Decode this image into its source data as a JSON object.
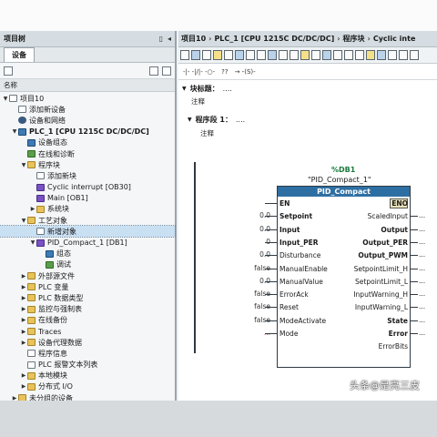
{
  "left_pane": {
    "title": "项目树",
    "tab": "设备",
    "column_header": "名称",
    "items": [
      {
        "label": "项目10",
        "level": 0,
        "toggle": "▼",
        "icon": "doc"
      },
      {
        "label": "添加新设备",
        "level": 1,
        "toggle": "",
        "icon": "doc"
      },
      {
        "label": "设备和网络",
        "level": 1,
        "toggle": "",
        "icon": "gear"
      },
      {
        "label": "PLC_1 [CPU 1215C DC/DC/DC]",
        "level": 1,
        "toggle": "▼",
        "icon": "cpu",
        "bold": true
      },
      {
        "label": "设备组态",
        "level": 2,
        "toggle": "",
        "icon": "cpu"
      },
      {
        "label": "在线和诊断",
        "level": 2,
        "toggle": "",
        "icon": "grn"
      },
      {
        "label": "程序块",
        "level": 2,
        "toggle": "▼",
        "icon": "folder"
      },
      {
        "label": "添加新块",
        "level": 3,
        "toggle": "",
        "icon": "doc"
      },
      {
        "label": "Cyclic interrupt [OB30]",
        "level": 3,
        "toggle": "",
        "icon": "blk"
      },
      {
        "label": "Main [OB1]",
        "level": 3,
        "toggle": "",
        "icon": "blk"
      },
      {
        "label": "系统块",
        "level": 3,
        "toggle": "▶",
        "icon": "folder"
      },
      {
        "label": "工艺对象",
        "level": 2,
        "toggle": "▼",
        "icon": "folder"
      },
      {
        "label": "新增对象",
        "level": 3,
        "toggle": "",
        "icon": "doc",
        "selected": true
      },
      {
        "label": "PID_Compact_1 [DB1]",
        "level": 3,
        "toggle": "▼",
        "icon": "blk"
      },
      {
        "label": "组态",
        "level": 4,
        "toggle": "",
        "icon": "cpu"
      },
      {
        "label": "调试",
        "level": 4,
        "toggle": "",
        "icon": "grn"
      },
      {
        "label": "外部源文件",
        "level": 2,
        "toggle": "▶",
        "icon": "folder"
      },
      {
        "label": "PLC 变量",
        "level": 2,
        "toggle": "▶",
        "icon": "folder"
      },
      {
        "label": "PLC 数据类型",
        "level": 2,
        "toggle": "▶",
        "icon": "folder"
      },
      {
        "label": "监控与强制表",
        "level": 2,
        "toggle": "▶",
        "icon": "folder"
      },
      {
        "label": "在线备份",
        "level": 2,
        "toggle": "▶",
        "icon": "folder"
      },
      {
        "label": "Traces",
        "level": 2,
        "toggle": "▶",
        "icon": "folder"
      },
      {
        "label": "设备代理数据",
        "level": 2,
        "toggle": "▶",
        "icon": "folder"
      },
      {
        "label": "程序信息",
        "level": 2,
        "toggle": "",
        "icon": "doc"
      },
      {
        "label": "PLC 报警文本列表",
        "level": 2,
        "toggle": "",
        "icon": "doc"
      },
      {
        "label": "本地模块",
        "level": 2,
        "toggle": "▶",
        "icon": "folder"
      },
      {
        "label": "分布式 I/O",
        "level": 2,
        "toggle": "▶",
        "icon": "folder"
      },
      {
        "label": "未分组的设备",
        "level": 1,
        "toggle": "▶",
        "icon": "folder"
      }
    ]
  },
  "right_pane": {
    "breadcrumb": [
      "项目10",
      "PLC_1 [CPU 1215C DC/DC/DC]",
      "程序块",
      "Cyclic inte"
    ],
    "favorites": [
      "-|- -|/|- -○- ",
      "?? ",
      "→ -(S)-"
    ],
    "block_title_label": "块标题：",
    "block_title_value": "....",
    "block_comment": "注释",
    "network_label": "程序段 1：",
    "network_value": "....",
    "network_comment": "注释"
  },
  "block": {
    "db": "%DB1",
    "instance": "\"PID_Compact_1\"",
    "name": "PID_Compact",
    "inputs": [
      {
        "pin": "EN",
        "value": "",
        "bold": true
      },
      {
        "pin": "Setpoint",
        "value": "0.0",
        "bold": true
      },
      {
        "pin": "Input",
        "value": "0.0",
        "bold": true
      },
      {
        "pin": "Input_PER",
        "value": "0",
        "bold": true
      },
      {
        "pin": "Disturbance",
        "value": "0.0",
        "bold": false
      },
      {
        "pin": "ManualEnable",
        "value": "false",
        "bold": false
      },
      {
        "pin": "ManualValue",
        "value": "0.0",
        "bold": false
      },
      {
        "pin": "ErrorAck",
        "value": "false",
        "bold": false
      },
      {
        "pin": "Reset",
        "value": "false",
        "bold": false
      },
      {
        "pin": "ModeActivate",
        "value": "false",
        "bold": false
      },
      {
        "pin": "Mode",
        "value": "...",
        "bold": false
      }
    ],
    "outputs": [
      {
        "pin": "ENO",
        "value": "",
        "bold": true
      },
      {
        "pin": "ScaledInput",
        "value": "...",
        "bold": false
      },
      {
        "pin": "Output",
        "value": "...",
        "bold": true
      },
      {
        "pin": "Output_PER",
        "value": "...",
        "bold": true
      },
      {
        "pin": "Output_PWM",
        "value": "...",
        "bold": true
      },
      {
        "pin": "SetpointLimit_H",
        "value": "...",
        "bold": false
      },
      {
        "pin": "SetpointLimit_L",
        "value": "...",
        "bold": false
      },
      {
        "pin": "InputWarning_H",
        "value": "...",
        "bold": false
      },
      {
        "pin": "InputWarning_L",
        "value": "...",
        "bold": false
      },
      {
        "pin": "State",
        "value": "...",
        "bold": true
      },
      {
        "pin": "Error",
        "value": "...",
        "bold": true
      },
      {
        "pin": "ErrorBits",
        "value": "",
        "bold": false
      }
    ]
  },
  "watermark": "头条@是亮三皮"
}
